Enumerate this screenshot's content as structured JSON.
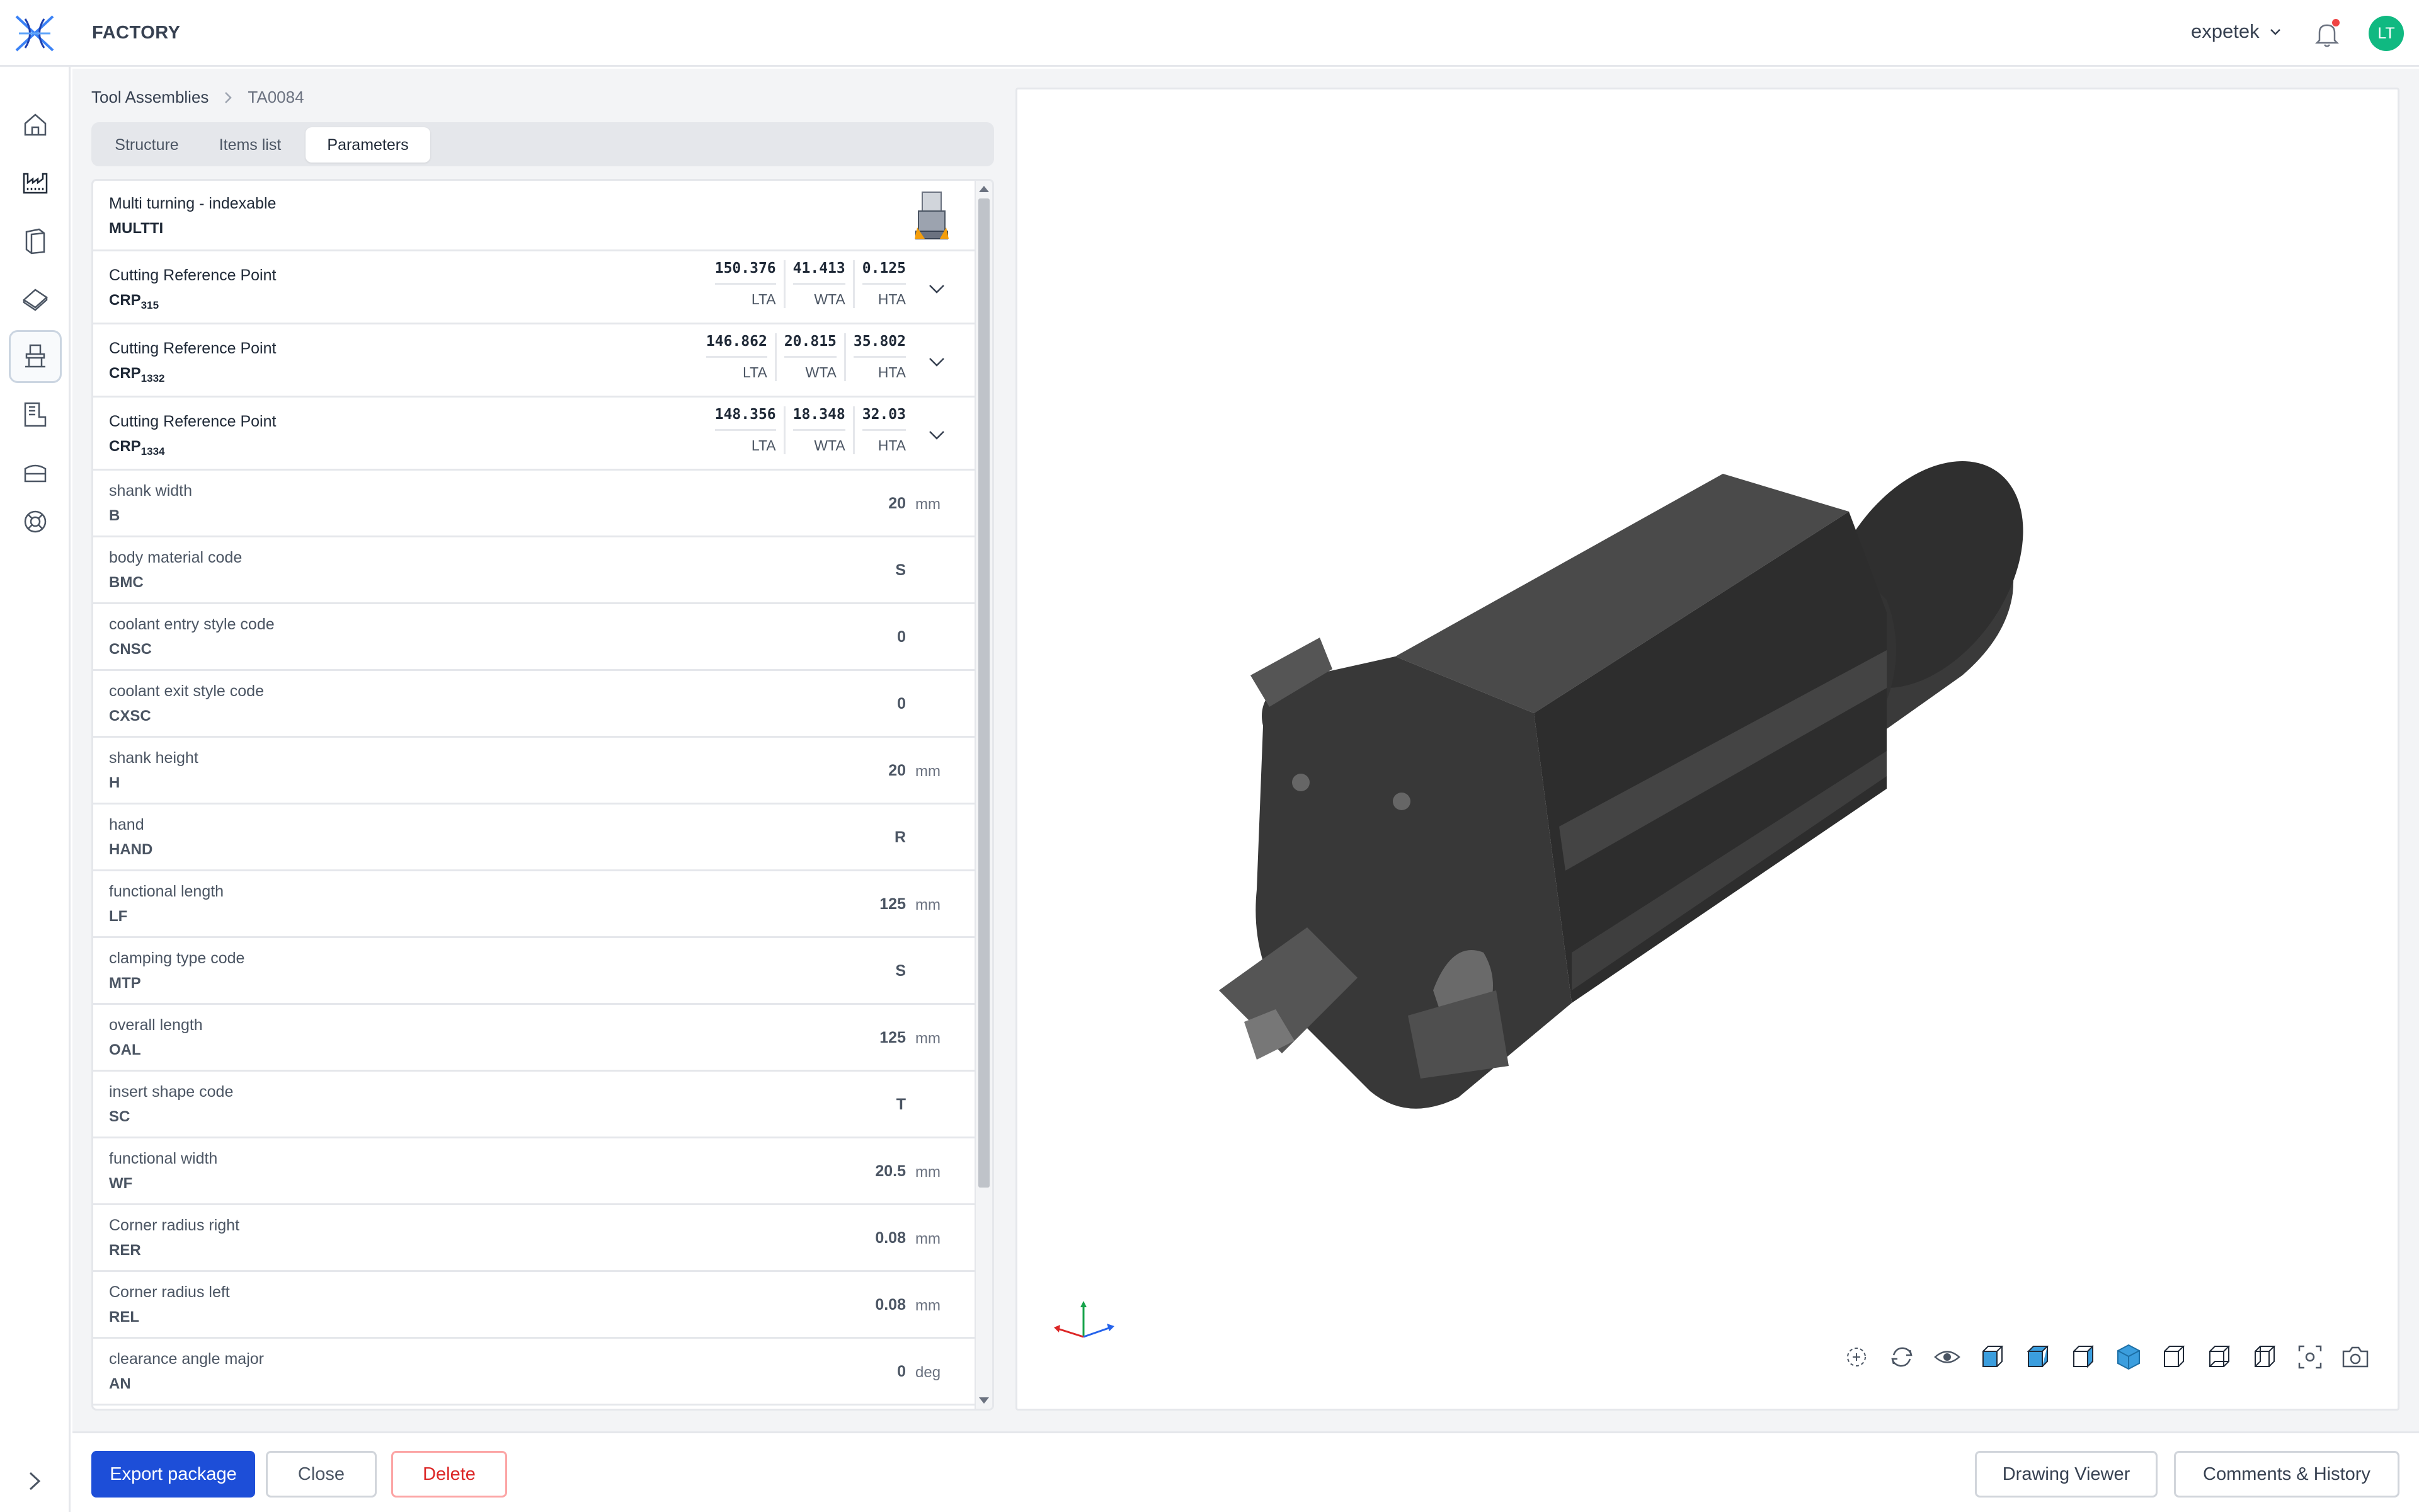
{
  "app": {
    "title": "FACTORY"
  },
  "header": {
    "org": "expetek",
    "avatar_initials": "LT"
  },
  "breadcrumb": {
    "root": "Tool Assemblies",
    "current": "TA0084"
  },
  "tabs": [
    {
      "label": "Structure",
      "active": false
    },
    {
      "label": "Items list",
      "active": false
    },
    {
      "label": "Parameters",
      "active": true
    }
  ],
  "assembly": {
    "type_label": "Multi turning - indexable",
    "type_code": "MULTTI"
  },
  "crps": [
    {
      "label": "Cutting Reference Point",
      "code": "CRP",
      "sub": "315",
      "lta": "150.376",
      "wta": "41.413",
      "hta": "0.125"
    },
    {
      "label": "Cutting Reference Point",
      "code": "CRP",
      "sub": "1332",
      "lta": "146.862",
      "wta": "20.815",
      "hta": "35.802"
    },
    {
      "label": "Cutting Reference Point",
      "code": "CRP",
      "sub": "1334",
      "lta": "148.356",
      "wta": "18.348",
      "hta": "32.03"
    }
  ],
  "axis_labels": {
    "lta": "LTA",
    "wta": "WTA",
    "hta": "HTA"
  },
  "params": [
    {
      "label": "shank width",
      "code": "B",
      "value": "20",
      "unit": "mm"
    },
    {
      "label": "body material code",
      "code": "BMC",
      "value": "S",
      "unit": ""
    },
    {
      "label": "coolant entry style code",
      "code": "CNSC",
      "value": "0",
      "unit": ""
    },
    {
      "label": "coolant exit style code",
      "code": "CXSC",
      "value": "0",
      "unit": ""
    },
    {
      "label": "shank height",
      "code": "H",
      "value": "20",
      "unit": "mm"
    },
    {
      "label": "hand",
      "code": "HAND",
      "value": "R",
      "unit": ""
    },
    {
      "label": "functional length",
      "code": "LF",
      "value": "125",
      "unit": "mm"
    },
    {
      "label": "clamping type code",
      "code": "MTP",
      "value": "S",
      "unit": ""
    },
    {
      "label": "overall length",
      "code": "OAL",
      "value": "125",
      "unit": "mm"
    },
    {
      "label": "insert shape code",
      "code": "SC",
      "value": "T",
      "unit": ""
    },
    {
      "label": "functional width",
      "code": "WF",
      "value": "20.5",
      "unit": "mm"
    },
    {
      "label": "Corner radius right",
      "code": "RER",
      "value": "0.08",
      "unit": "mm"
    },
    {
      "label": "Corner radius left",
      "code": "REL",
      "value": "0.08",
      "unit": "mm"
    },
    {
      "label": "clearance angle major",
      "code": "AN",
      "value": "0",
      "unit": "deg"
    }
  ],
  "footer": {
    "export_label": "Export package",
    "close_label": "Close",
    "delete_label": "Delete",
    "drawing_label": "Drawing Viewer",
    "comments_label": "Comments & History"
  },
  "colors": {
    "primary": "#1d4ed8",
    "danger": "#dc2626",
    "avatar": "#10b981",
    "notification": "#ef4444",
    "viewer_accent": "#3b9ede"
  }
}
